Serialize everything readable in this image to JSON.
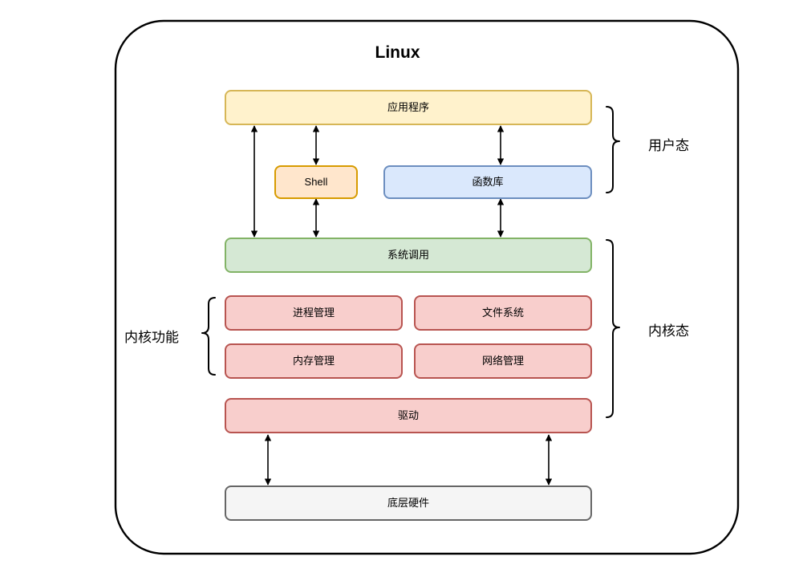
{
  "diagram": {
    "title": "Linux",
    "outline_shape": "rounded-rectangle"
  },
  "boxes": {
    "application": {
      "label": "应用程序",
      "fill": "#fff2cc",
      "stroke": "#d6b656"
    },
    "shell": {
      "label": "Shell",
      "fill": "#ffe6cc",
      "stroke": "#d79b00"
    },
    "library": {
      "label": "函数库",
      "fill": "#dae8fc",
      "stroke": "#6c8ebf"
    },
    "syscall": {
      "label": "系统调用",
      "fill": "#d5e8d4",
      "stroke": "#82b366"
    },
    "process_mgmt": {
      "label": "进程管理",
      "fill": "#f8cecc",
      "stroke": "#b85450"
    },
    "filesystem": {
      "label": "文件系统",
      "fill": "#f8cecc",
      "stroke": "#b85450"
    },
    "memory_mgmt": {
      "label": "内存管理",
      "fill": "#f8cecc",
      "stroke": "#b85450"
    },
    "network_mgmt": {
      "label": "网络管理",
      "fill": "#f8cecc",
      "stroke": "#b85450"
    },
    "driver": {
      "label": "驱动",
      "fill": "#f8cecc",
      "stroke": "#b85450"
    },
    "hardware": {
      "label": "底层硬件",
      "fill": "#f5f5f5",
      "stroke": "#666666"
    }
  },
  "annotations": {
    "user_mode": {
      "label": "用户态",
      "bracket": "right-brace"
    },
    "kernel_mode": {
      "label": "内核态",
      "bracket": "right-brace"
    },
    "kernel_features": {
      "label": "内核功能",
      "bracket": "left-brace"
    }
  },
  "colors": {
    "outline": "#000000",
    "arrow": "#000000",
    "text": "#000000",
    "background": "#ffffff"
  }
}
